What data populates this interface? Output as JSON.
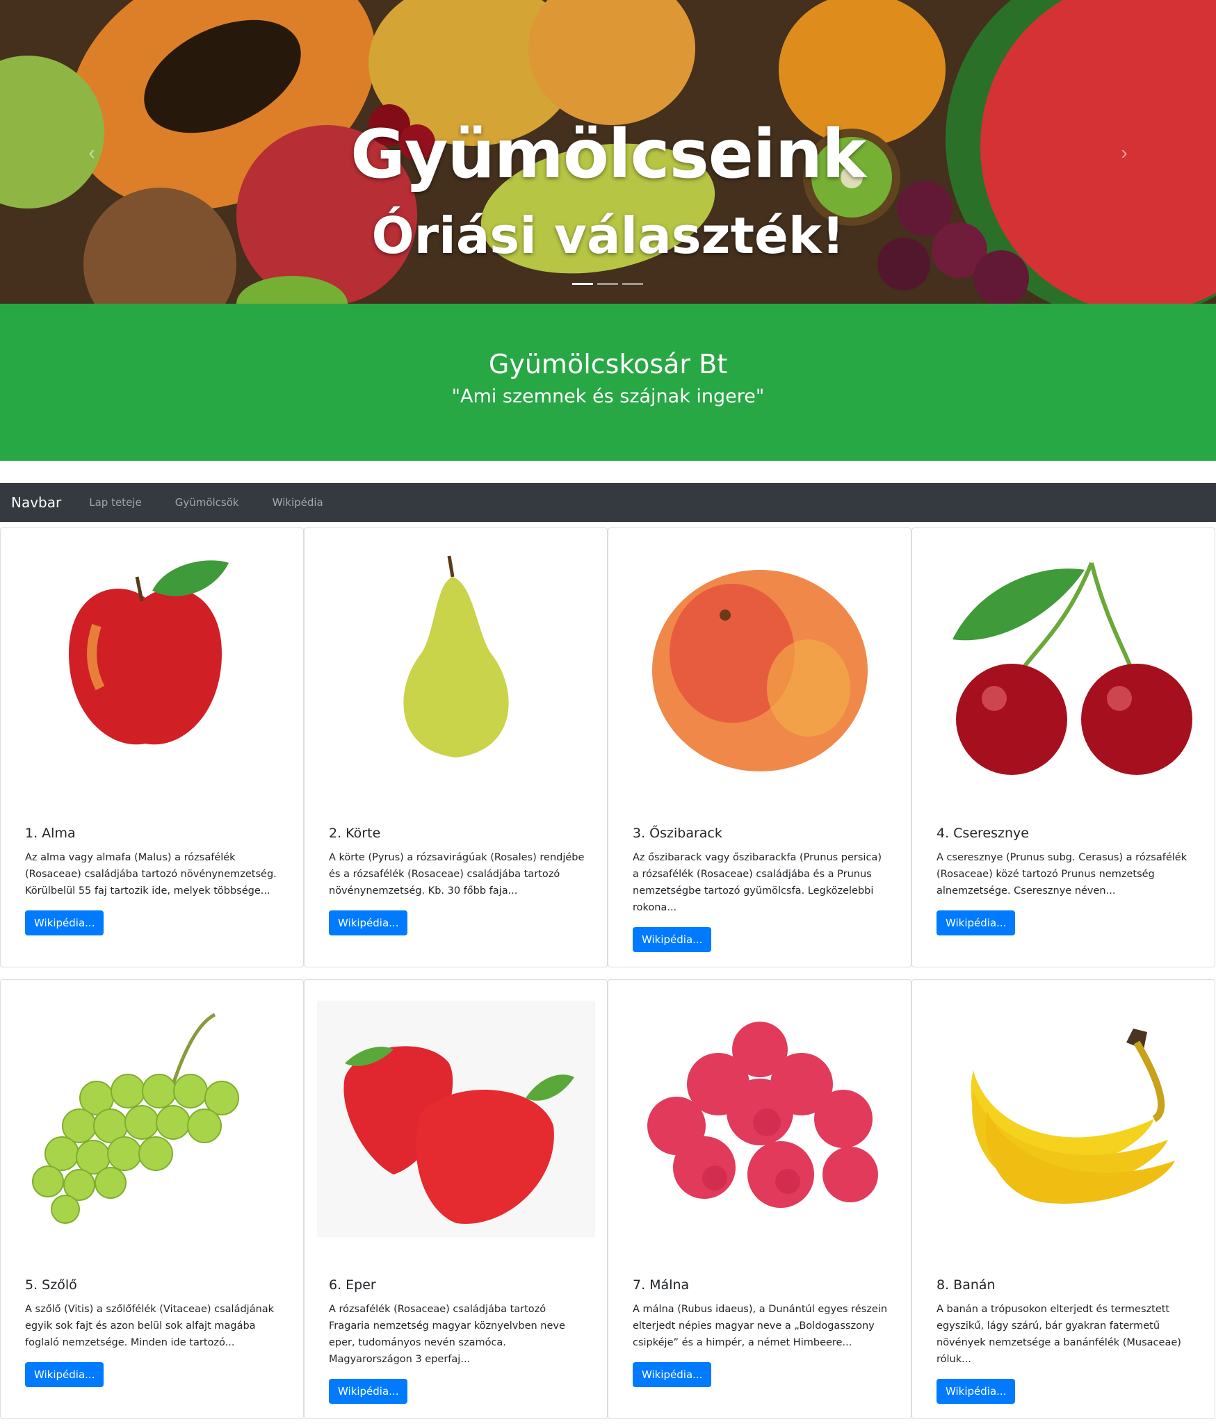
{
  "hero": {
    "title": "Gyümölcseink",
    "subtitle": "Óriási választék!",
    "prev_icon": "chevron-left-icon",
    "next_icon": "chevron-right-icon",
    "slides_count": 3,
    "active_slide": 1
  },
  "jumbotron": {
    "title": "Gyümölcskosár Bt",
    "tagline": "\"Ami szemnek és szájnak ingere\"",
    "bg_color": "#28a745"
  },
  "navbar": {
    "brand": "Navbar",
    "links": [
      "Lap teteje",
      "Gyümölcsök",
      "Wikipédia"
    ],
    "bg_color": "#343a40"
  },
  "cards": [
    {
      "title": "1. Alma",
      "text": "Az alma vagy almafa (Malus) a rózsafélék (Rosaceae) családjába tartozó növénynemzetség. Körülbelül 55 faj tartozik ide, melyek többsége...",
      "button": "Wikipédia...",
      "image": "apple-image"
    },
    {
      "title": "2. Körte",
      "text": "A körte (Pyrus) a rózsavirágúak (Rosales) rendjébe és a rózsafélék (Rosaceae) családjába tartozó növénynemzetség. Kb. 30 főbb faja...",
      "button": "Wikipédia...",
      "image": "pear-image"
    },
    {
      "title": "3. Őszibarack",
      "text": "Az őszibarack vagy őszibarackfa (Prunus persica) a rózsafélék (Rosaceae) családjába és a Prunus nemzetségbe tartozó gyümölcsfa. Legközelebbi rokona...",
      "button": "Wikipédia...",
      "image": "peach-image"
    },
    {
      "title": "4. Cseresznye",
      "text": "A cseresznye (Prunus subg. Cerasus) a rózsafélék (Rosaceae) közé tartozó Prunus nemzetség alnemzetsége. Cseresznye néven...",
      "button": "Wikipédia...",
      "image": "cherry-image"
    },
    {
      "title": "5. Szőlő",
      "text": "A szőlő (Vitis) a szőlőfélék (Vitaceae) családjának egyik sok fajt és azon belül sok alfajt magába foglaló nemzetsége. Minden ide tartozó...",
      "button": "Wikipédia...",
      "image": "grape-image"
    },
    {
      "title": "6. Eper",
      "text": "A rózsafélék (Rosaceae) családjába tartozó Fragaria nemzetség magyar köznyelvben neve eper, tudományos nevén szamóca. Magyarországon 3 eperfaj...",
      "button": "Wikipédia...",
      "image": "strawberry-image"
    },
    {
      "title": "7. Málna",
      "text": "A málna (Rubus idaeus), a Dunántúl egyes részein elterjedt népies magyar neve a „Boldogasszony csipkéje” és a himpér, a német Himbeere...",
      "button": "Wikipédia...",
      "image": "raspberry-image"
    },
    {
      "title": "8. Banán",
      "text": "A banán a trópusokon elterjedt és termesztett egyszikű, lágy szárú, bár gyakran fatermetű növények nemzetsége a banánfélék (Musaceae) róluk...",
      "button": "Wikipédia...",
      "image": "banana-image"
    }
  ],
  "colors": {
    "primary_button": "#007bff",
    "card_border": "#dcdcdc"
  }
}
